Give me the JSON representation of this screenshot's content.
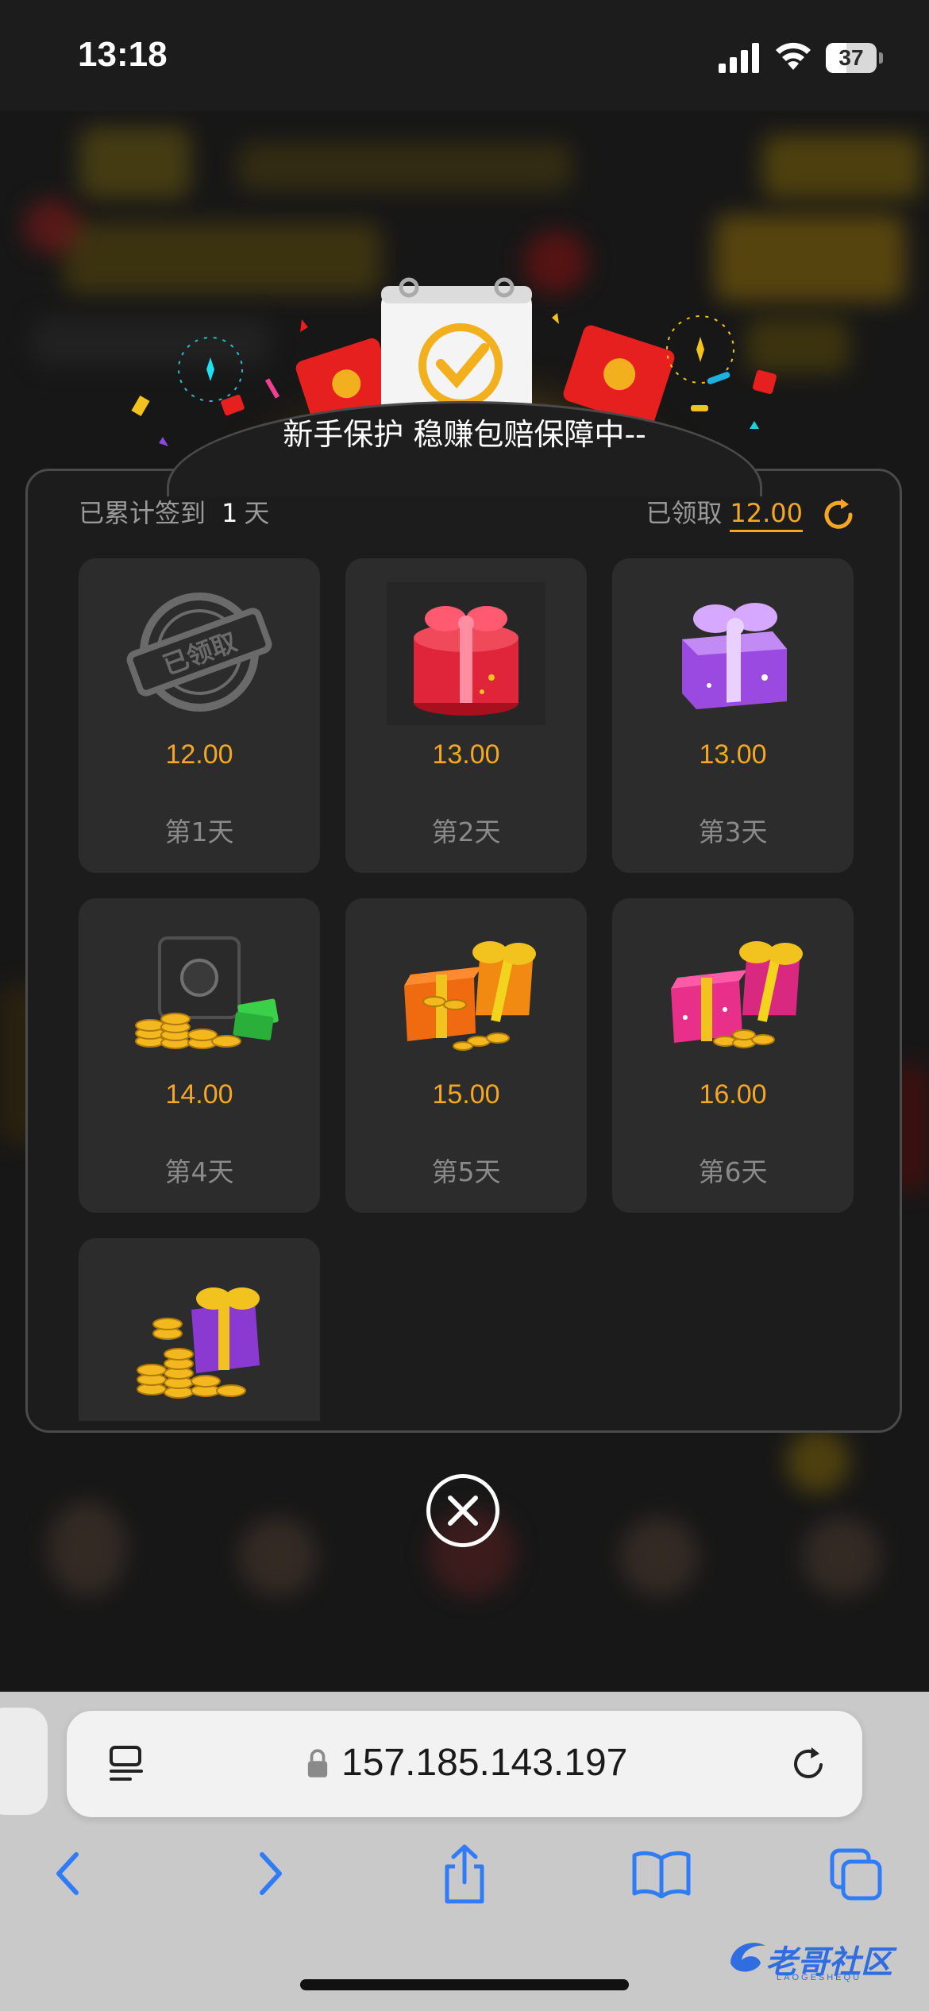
{
  "status_bar": {
    "time": "13:18",
    "battery": "37"
  },
  "dialog": {
    "title": "新手保护 稳赚包赔保障中--",
    "signed_prefix": "已累计签到",
    "signed_days": "1",
    "signed_suffix": "天",
    "claimed_label": "已领取",
    "claimed_value": "12.00",
    "claimed_stamp": "已领取",
    "cards": [
      {
        "amount": "12.00",
        "day": "第1天",
        "icon": "claimed-stamp-icon",
        "claimed": true
      },
      {
        "amount": "13.00",
        "day": "第2天",
        "icon": "red-gift-box-icon"
      },
      {
        "amount": "13.00",
        "day": "第3天",
        "icon": "purple-gift-box-icon"
      },
      {
        "amount": "14.00",
        "day": "第4天",
        "icon": "safe-with-coins-icon"
      },
      {
        "amount": "15.00",
        "day": "第5天",
        "icon": "orange-gift-with-coins-icon"
      },
      {
        "amount": "16.00",
        "day": "第6天",
        "icon": "pink-gift-with-coins-icon"
      },
      {
        "icon": "purple-gift-with-coins-icon"
      }
    ]
  },
  "browser": {
    "url": "157.185.143.197"
  },
  "watermark": {
    "text": "老哥社区",
    "sub": "LAOGESHEQU"
  },
  "colors": {
    "accent": "#f5a623",
    "card_bg": "#2c2c2c",
    "dialog_bg": "#1c1c1c",
    "safari_blue": "#2f7cf6"
  }
}
